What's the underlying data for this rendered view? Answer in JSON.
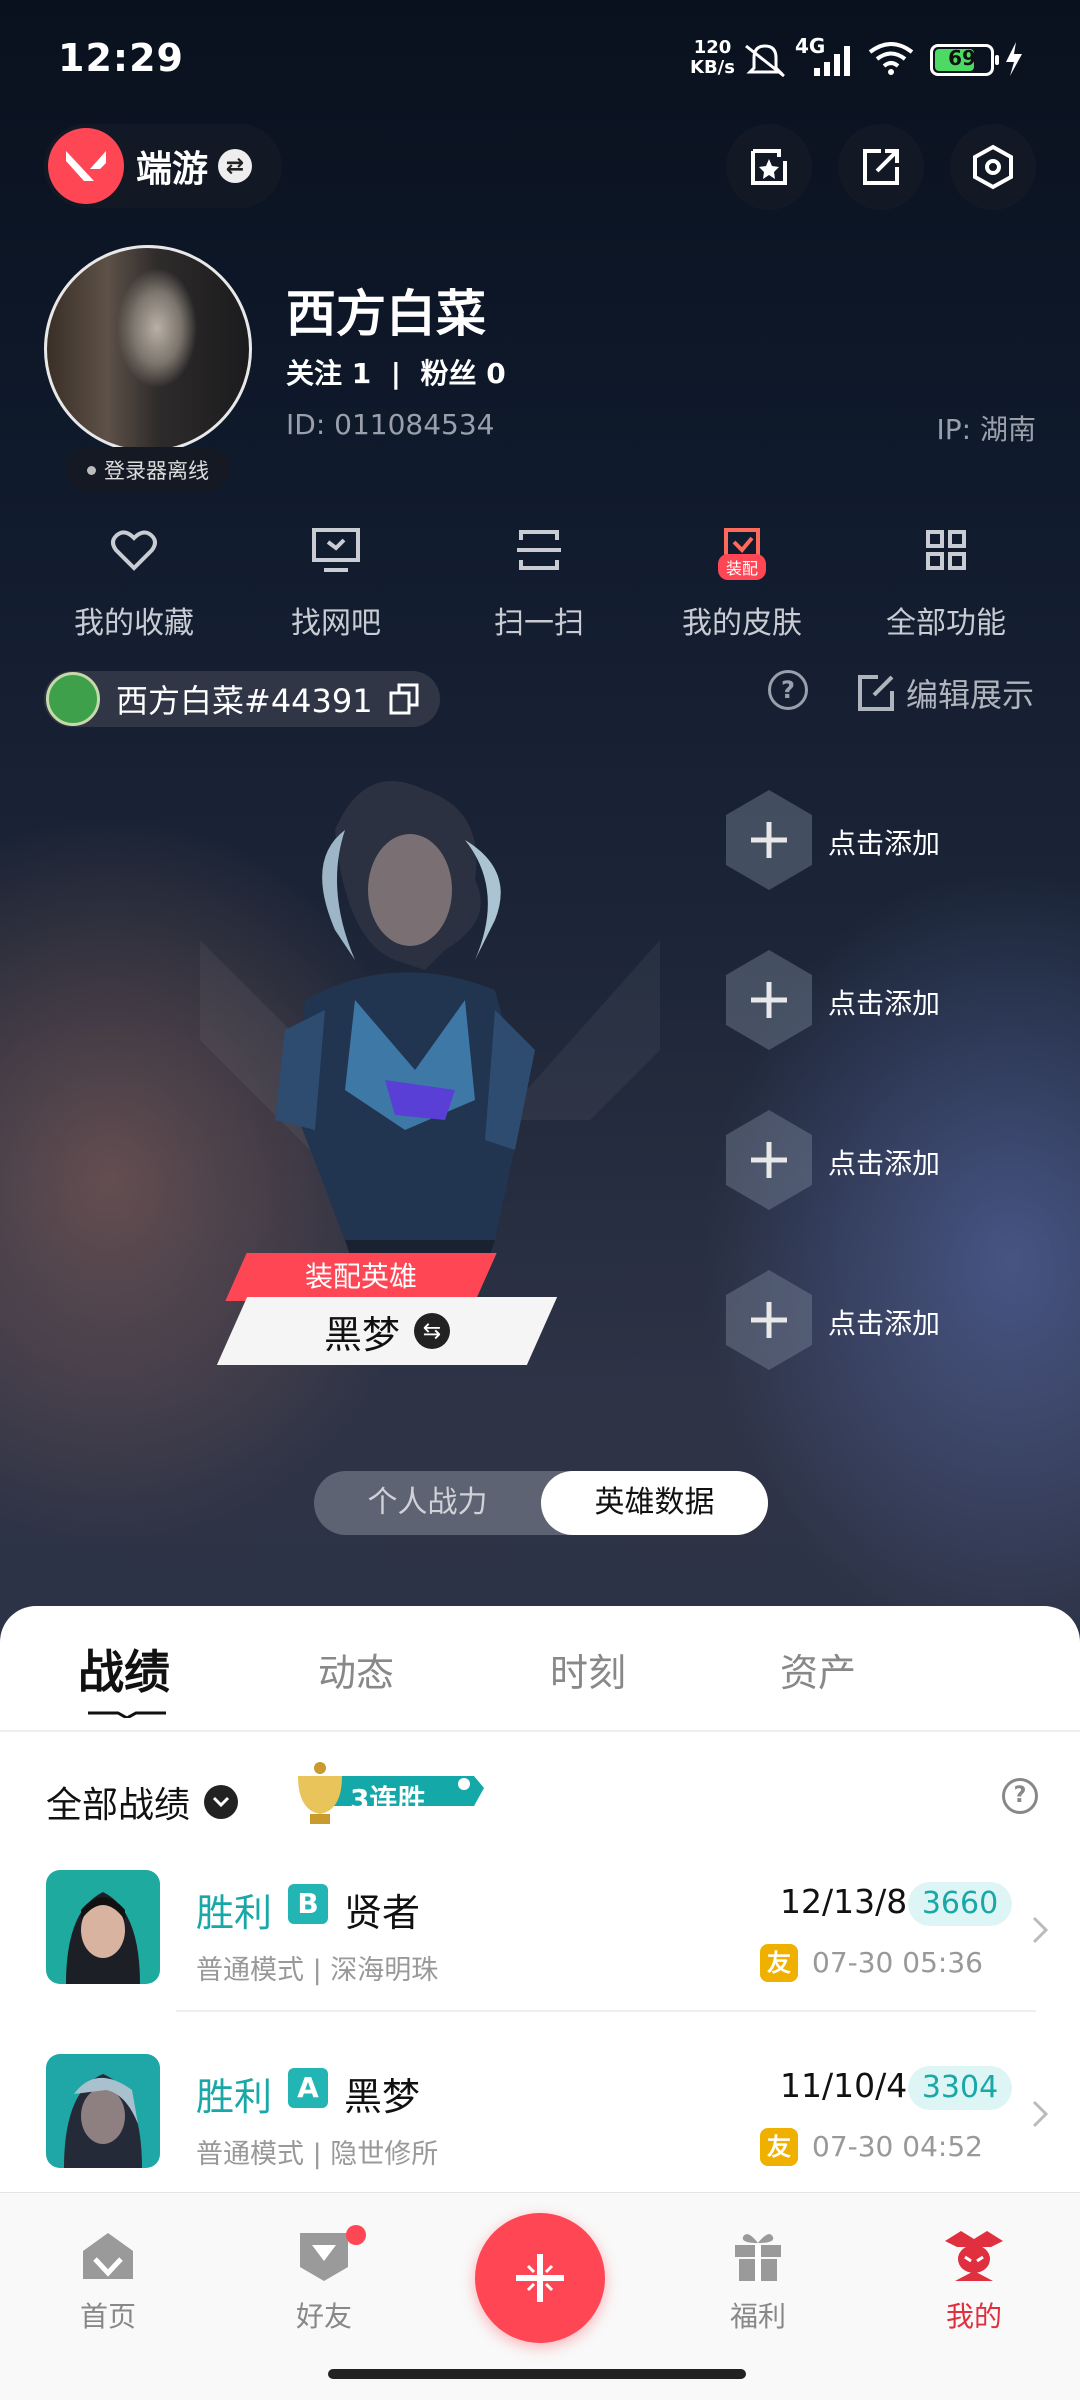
{
  "status_bar": {
    "time": "12:29",
    "net_speed_value": "120",
    "net_speed_unit": "KB/s",
    "network": "4G",
    "battery": "69"
  },
  "header": {
    "mode": "端游"
  },
  "profile": {
    "name": "西方白菜",
    "follow": "关注 1  |  粉丝 0",
    "id": "ID: 011084534",
    "ip": "IP: 湖南",
    "status": "登录器离线"
  },
  "quick_actions": [
    {
      "label": "我的收藏",
      "icon": "heart-icon"
    },
    {
      "label": "找网吧",
      "icon": "monitor-icon"
    },
    {
      "label": "扫一扫",
      "icon": "scan-icon"
    },
    {
      "label": "我的皮肤",
      "icon": "skin-icon",
      "badge": "装配"
    },
    {
      "label": "全部功能",
      "icon": "grid-icon"
    }
  ],
  "riot_id": "西方白菜#44391",
  "edit_label": "编辑展示",
  "hero": {
    "equip_label": "装配英雄",
    "name": "黑梦"
  },
  "slots": [
    "点击添加",
    "点击添加",
    "点击添加",
    "点击添加"
  ],
  "toggle": {
    "left": "个人战力",
    "right": "英雄数据",
    "active": "right"
  },
  "tabs": [
    "战绩",
    "动态",
    "时刻",
    "资产"
  ],
  "filter": {
    "label": "全部战绩",
    "streak": "3连胜"
  },
  "matches": [
    {
      "result": "胜利",
      "rank": "B",
      "agent": "贤者",
      "mode": "普通模式 | 深海明珠",
      "kda": "12/13/8",
      "score": "3660",
      "friend_badge": "友",
      "time": "07-30 05:36"
    },
    {
      "result": "胜利",
      "rank": "A",
      "agent": "黑梦",
      "mode": "普通模式 | 隐世修所",
      "kda": "11/10/4",
      "score": "3304",
      "friend_badge": "友",
      "time": "07-30 04:52"
    }
  ],
  "nav": [
    {
      "label": "首页",
      "icon": "home-icon"
    },
    {
      "label": "好友",
      "icon": "friends-icon"
    },
    {
      "label": "",
      "icon": "plus-icon"
    },
    {
      "label": "福利",
      "icon": "gift-icon"
    },
    {
      "label": "我的",
      "icon": "profile-icon"
    }
  ],
  "colors": {
    "accent": "#ff4655",
    "teal": "#1aa7a7",
    "nav_active": "#e0303f"
  }
}
